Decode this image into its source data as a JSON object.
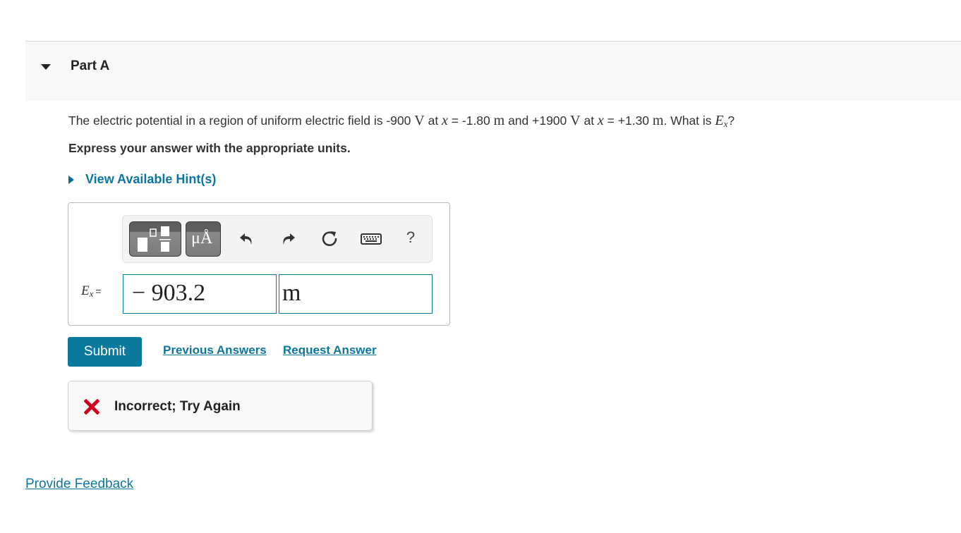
{
  "part": {
    "title": "Part A",
    "toggle_icon": "triangle-down-icon"
  },
  "question": {
    "intro": "The electric potential in a region of uniform electric field is ",
    "v1": "-900",
    "unit_v": "V",
    "at": " at ",
    "var_x": "x",
    "eq1": " = -1.80 ",
    "unit_m": "m",
    "and": " and +1900 ",
    "eq2": " = +1.30 ",
    "what_is": ". What is ",
    "E": "E",
    "sub_x": "x",
    "qmark": "?"
  },
  "instruction": "Express your answer with the appropriate units.",
  "hint": {
    "label": "View Available Hint(s)",
    "icon": "triangle-right-icon"
  },
  "toolbar": {
    "templates_icon": "templates-icon",
    "units_label": "μÅ",
    "undo_icon": "undo-icon",
    "redo_icon": "redo-icon",
    "reset_icon": "reset-icon",
    "keyboard_icon": "keyboard-icon",
    "help_label": "?"
  },
  "answer": {
    "label_var": "E",
    "label_sub": "x",
    "label_eq": "=",
    "value": "− 903.2",
    "unit": "m"
  },
  "actions": {
    "submit_label": "Submit",
    "previous_answers_label": "Previous Answers",
    "request_answer_label": "Request Answer"
  },
  "feedback": {
    "status": "Incorrect; Try Again",
    "status_icon": "x-mark-icon",
    "status_color": "#d0021b"
  },
  "footer": {
    "provide_feedback_label": "Provide Feedback"
  },
  "colors": {
    "accent": "#0b7a9c",
    "header_bg": "#f8f8f8"
  }
}
